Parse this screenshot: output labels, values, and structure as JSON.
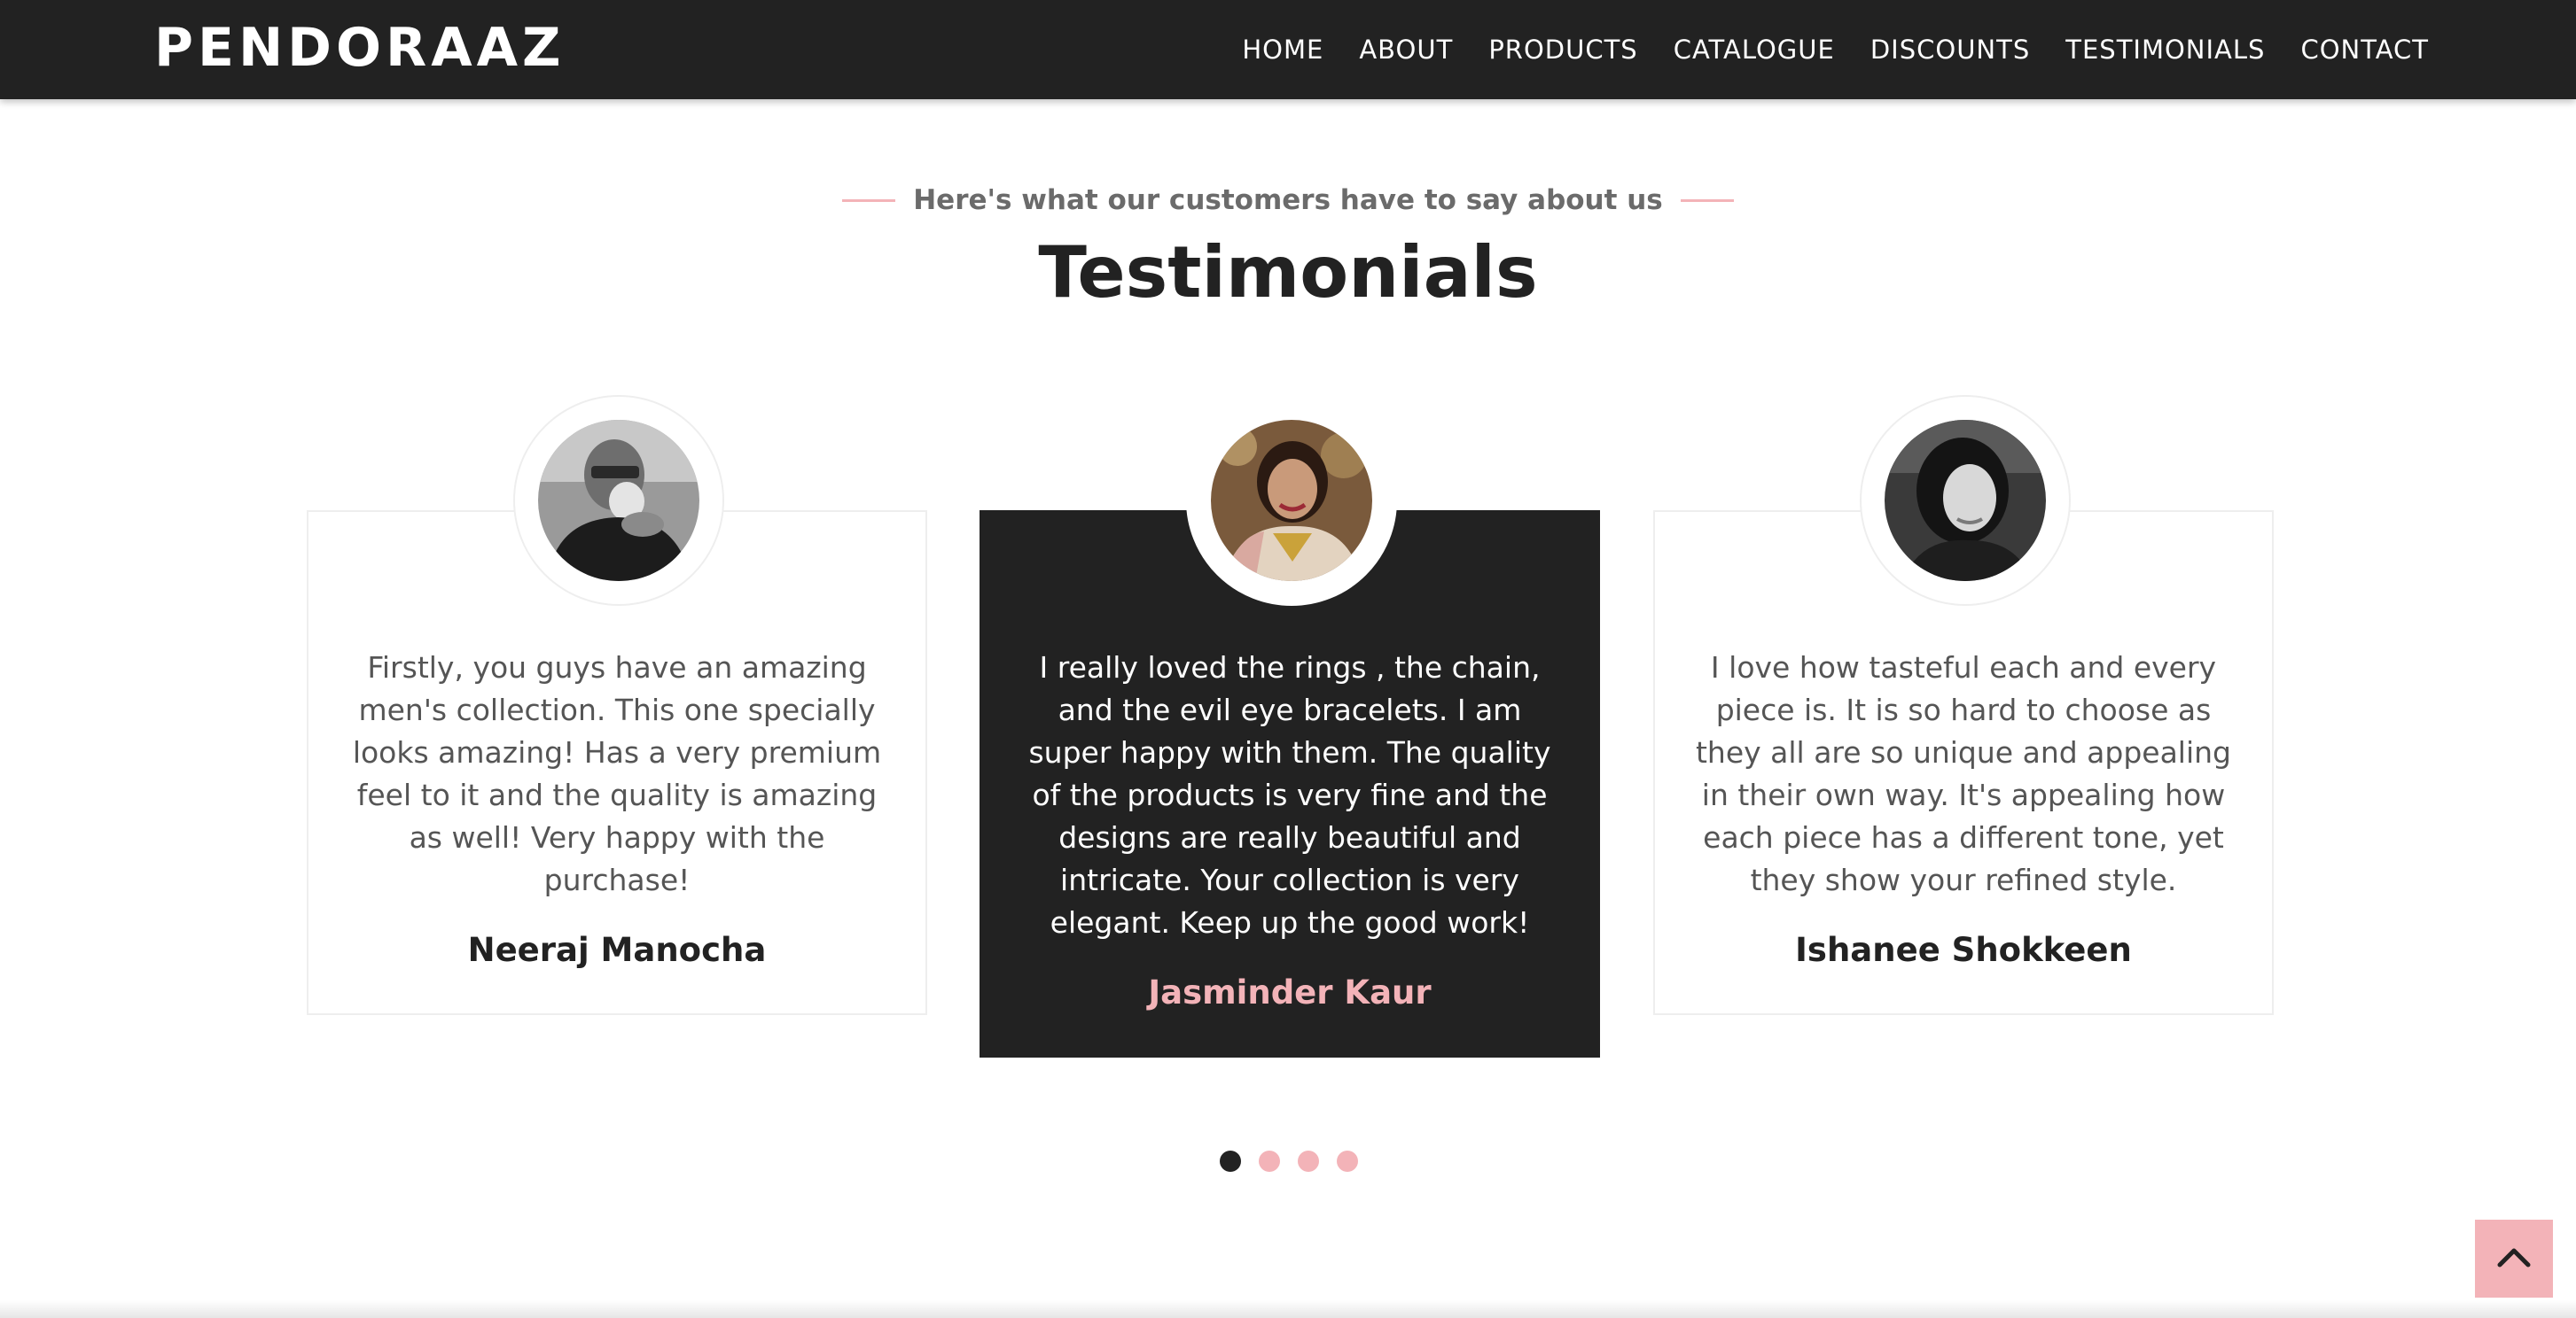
{
  "brand": "PENDORAAZ",
  "nav": [
    "HOME",
    "ABOUT",
    "PRODUCTS",
    "CATALOGUE",
    "DISCOUNTS",
    "TESTIMONIALS",
    "CONTACT"
  ],
  "section": {
    "kicker": "Here's what our customers have to say about us",
    "title": "Testimonials"
  },
  "testimonials": [
    {
      "quote": "Firstly, you guys have an amazing men's collection. This one specially looks amazing! Has a very premium feel to it and the quality is amazing as well! Very happy with the purchase!",
      "name": "Neeraj Manocha",
      "active": false
    },
    {
      "quote": "I really loved the rings , the chain, and the evil eye bracelets. I am super happy with them. The quality of the products is very fine and the designs are really beautiful and intricate. Your collection is very elegant. Keep up the good work!",
      "name": "Jasminder Kaur",
      "active": true
    },
    {
      "quote": "I love how tasteful each and every piece is. It is so hard to choose as they all are so unique and appealing in their own way. It's appealing how each piece has a different tone, yet they show your refined style.",
      "name": "Ishanee Shokkeen",
      "active": false
    }
  ],
  "carousel": {
    "total_pages": 4,
    "active_page": 1
  },
  "colors": {
    "dark": "#222222",
    "accent_pink": "#f3b3b8",
    "muted_text": "#555555"
  },
  "icons": {
    "back_to_top": "chevron-up-icon"
  }
}
